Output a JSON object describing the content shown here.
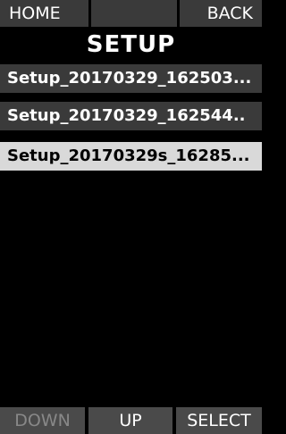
{
  "topbar": {
    "home": "HOME",
    "middle": "",
    "back": "BACK"
  },
  "title": "SETUP",
  "items": [
    {
      "label": "Setup_20170329_162503...",
      "selected": false
    },
    {
      "label": "Setup_20170329_162544..",
      "selected": false
    },
    {
      "label": "Setup_20170329s_16285...",
      "selected": true
    }
  ],
  "bottombar": {
    "down": "DOWN",
    "up": "UP",
    "select": "SELECT"
  }
}
